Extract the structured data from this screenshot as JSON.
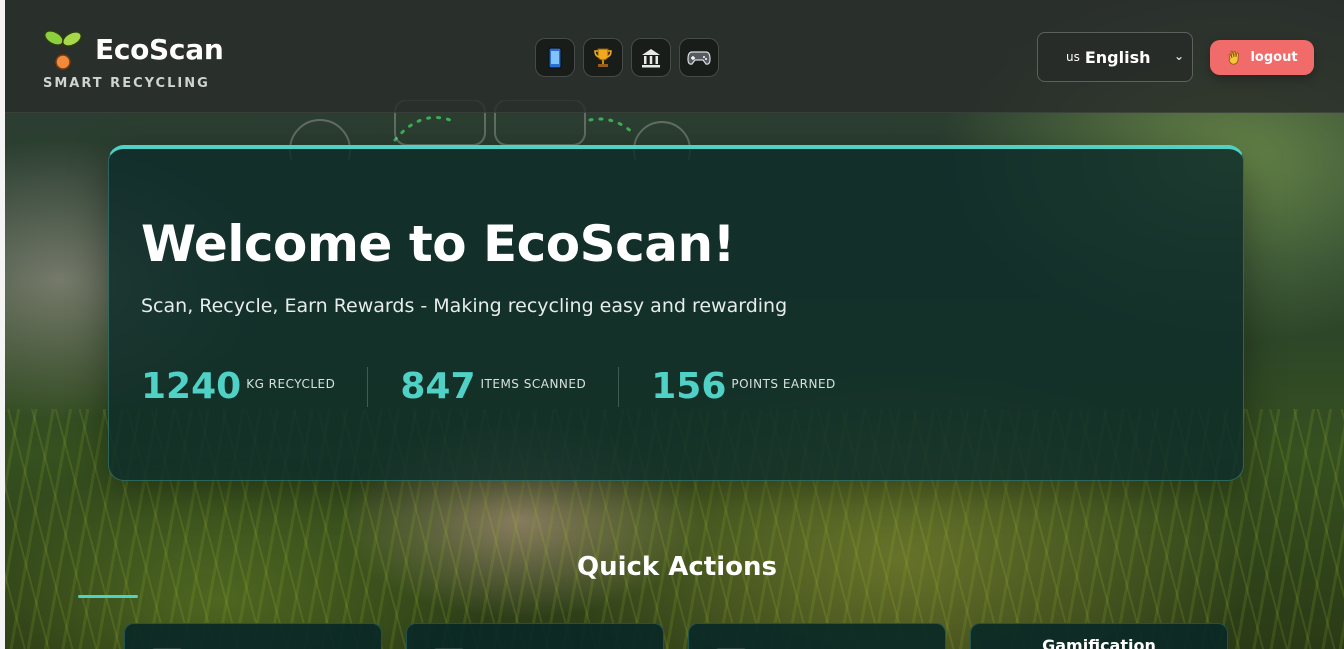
{
  "brand": {
    "name": "EcoScan",
    "tagline": "SMART RECYCLING"
  },
  "nav": {
    "items": [
      {
        "icon": "mobile-phone-icon"
      },
      {
        "icon": "trophy-icon"
      },
      {
        "icon": "bank-icon"
      },
      {
        "icon": "game-controller-icon"
      }
    ]
  },
  "language": {
    "flag": "us",
    "selected": "English"
  },
  "logout": {
    "label": "logout",
    "icon": "waving-hand-icon"
  },
  "hero": {
    "title": "Welcome to EcoScan!",
    "subtitle": "Scan, Recycle, Earn Rewards - Making recycling easy and rewarding",
    "stats": [
      {
        "value": "1240",
        "label": "KG RECYCLED"
      },
      {
        "value": "847",
        "label": "ITEMS SCANNED"
      },
      {
        "value": "156",
        "label": "POINTS EARNED"
      }
    ]
  },
  "quick_actions": {
    "title": "Quick Actions",
    "cards": [
      {
        "title": ""
      },
      {
        "title": ""
      },
      {
        "title": ""
      },
      {
        "title": "Gamification"
      }
    ]
  },
  "colors": {
    "accent": "#4fd1c5",
    "logout": "#f26b6b",
    "card": "#0e2c2a"
  }
}
